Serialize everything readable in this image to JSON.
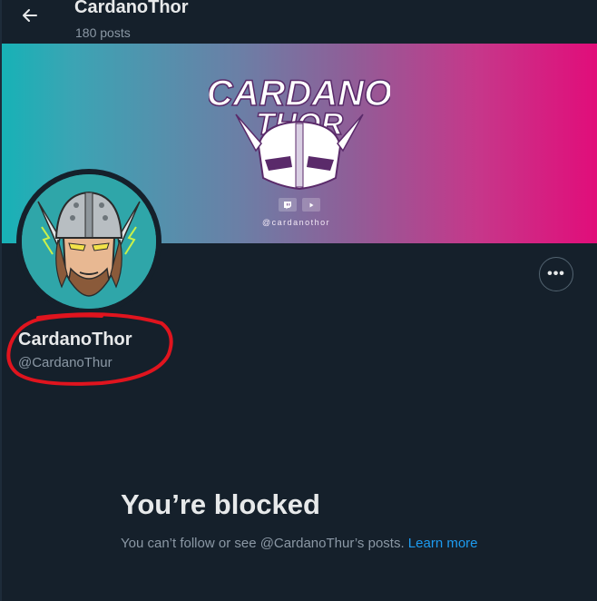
{
  "header": {
    "title": "CardanoThor",
    "subtitle": "180 posts",
    "back_icon": "arrow-left-icon"
  },
  "banner": {
    "logo_text_line1": "CARDANO",
    "logo_text_line2": "THOR",
    "handle": "@cardanothor",
    "social_icons": [
      "twitch-icon",
      "youtube-icon"
    ]
  },
  "profile": {
    "display_name": "CardanoThor",
    "handle": "@CardanoThur",
    "more_icon": "more-options-icon",
    "more_label": "•••"
  },
  "blocked": {
    "title": "You’re blocked",
    "message": "You can’t follow or see @CardanoThur’s posts. ",
    "link_text": "Learn more"
  },
  "colors": {
    "background": "#15202b",
    "accent": "#1d9bf0",
    "annotation_circle": "#e0141e",
    "banner_left": "#17b2b6",
    "banner_right": "#e10d7a"
  }
}
